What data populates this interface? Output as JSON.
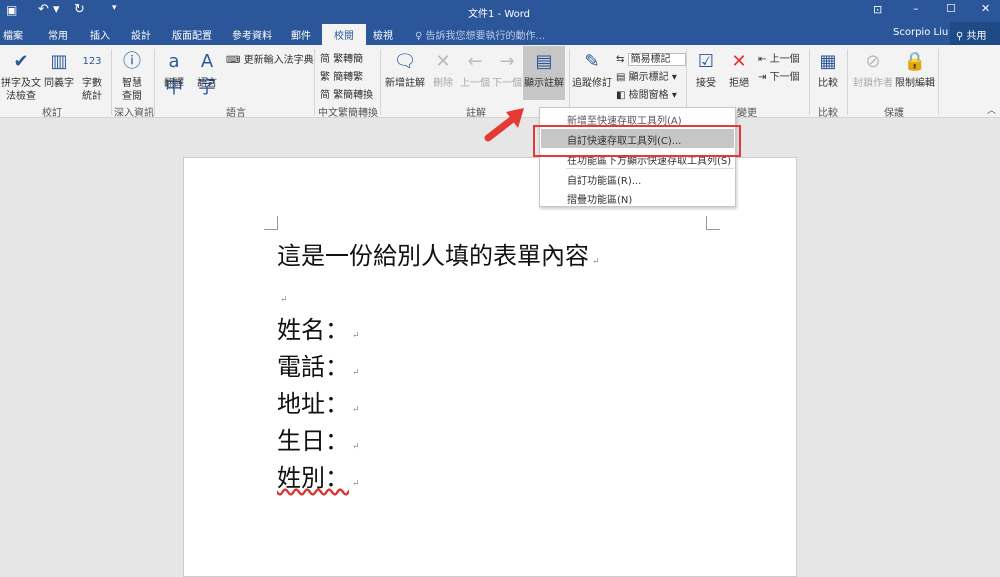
{
  "title_bar": {
    "doc_title": "文件1 - Word",
    "qat": [
      "save-icon",
      "undo-icon",
      "redo-icon",
      "customize-icon"
    ]
  },
  "tabs": [
    "檔案",
    "常用",
    "插入",
    "設計",
    "版面配置",
    "參考資料",
    "郵件",
    "校閱",
    "檢視"
  ],
  "tell_me": "告訴我您想要執行的動作...",
  "user": "Scorpio Liu",
  "share": "共用",
  "ribbon": {
    "proofing": {
      "spell": "拼字及文法檢查",
      "thesaurus": "同義字",
      "wordcount": "字數統計",
      "label": "校訂"
    },
    "insights": {
      "smart": "智慧查閱",
      "label": "深入資訊"
    },
    "language": {
      "translate": "翻譯",
      "language": "語言",
      "update_ime": "更新輸入法字典",
      "label": "語言"
    },
    "chinese": {
      "t2s": "繁轉簡",
      "s2t": "簡轉繁",
      "convert": "繁簡轉換",
      "label": "中文繁簡轉換"
    },
    "comments": {
      "new": "新增註解",
      "delete": "刪除",
      "prev": "上一個",
      "next": "下一個",
      "show": "顯示註解",
      "label": "註解"
    },
    "tracking": {
      "track": "追蹤修訂",
      "markup": "簡易標記",
      "show_markup": "顯示標記",
      "pane": "檢閱窗格"
    },
    "changes": {
      "accept": "接受",
      "reject": "拒絕",
      "prev": "上一個",
      "next": "下一個",
      "label": "變更"
    },
    "compare": {
      "compare": "比較",
      "label": "比較"
    },
    "protect": {
      "block": "封鎖作者",
      "restrict": "限制編輯",
      "label": "保護"
    }
  },
  "menu": [
    "新增至快速存取工具列(A)",
    "自訂快速存取工具列(C)...",
    "在功能區下方顯示快速存取工具列(S)",
    "自訂功能區(R)...",
    "摺疊功能區(N)"
  ],
  "document": {
    "lines": [
      "這是一份給別人填的表單內容",
      "",
      "姓名：",
      "電話：",
      "地址：",
      "生日：",
      "姓別："
    ]
  }
}
